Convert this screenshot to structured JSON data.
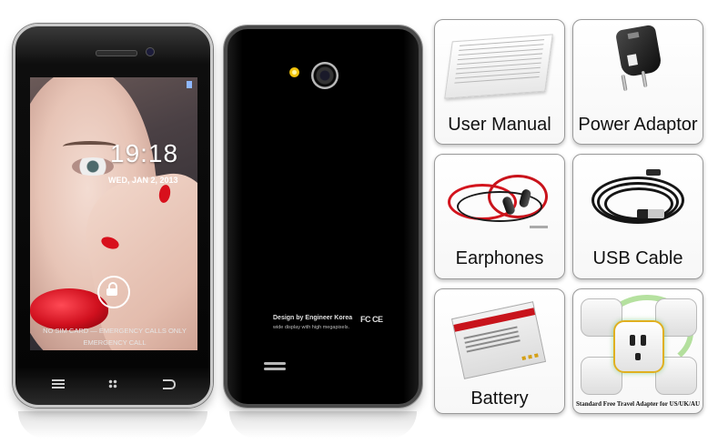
{
  "phones": {
    "front": {
      "lock_screen": {
        "time": "19:18",
        "date": "WED, JAN 2, 2013",
        "line1": "NO SIM CARD — EMERGENCY CALLS ONLY",
        "line2": "EMERGENCY CALL"
      }
    },
    "back": {
      "design_line": "Design by Engineer Korea",
      "sub_line": "wide display with high megapixels.",
      "cert": "FC CE"
    }
  },
  "accessories": [
    {
      "label": "User Manual",
      "icon": "user-manual"
    },
    {
      "label": "Power Adaptor",
      "icon": "power-adaptor"
    },
    {
      "label": "Earphones",
      "icon": "earphones"
    },
    {
      "label": "USB Cable",
      "icon": "usb-cable"
    },
    {
      "label": "Battery",
      "icon": "battery"
    },
    {
      "label": "Standard Free Travel Adapter for US/UK/AU",
      "icon": "travel-adapter"
    }
  ],
  "colors": {
    "card_border": "#9a9a9a",
    "phone_body": "#000000",
    "lipstick_red": "#d0101e",
    "flash_yellow": "#f2c40c"
  }
}
